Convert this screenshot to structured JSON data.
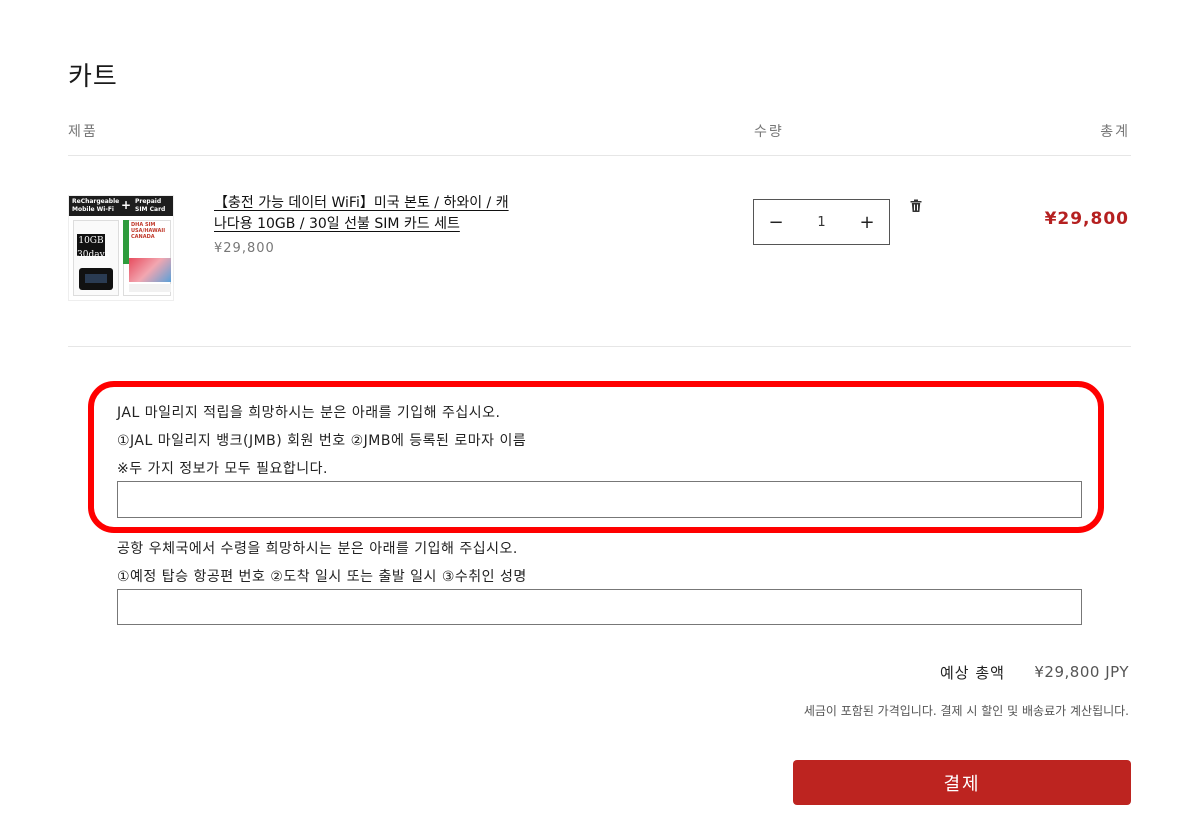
{
  "page": {
    "title": "카트"
  },
  "columns": {
    "product": "제품",
    "quantity": "수량",
    "total": "총계"
  },
  "item": {
    "thumbnail": {
      "band_left": "ReChargeable\nMobile Wi-Fi",
      "band_plus": "+",
      "band_right": "Prepaid\nSIM Card",
      "gb_label": "10GB\n30days",
      "card_text": "DHA SIM USA/HAWAII CANADA"
    },
    "title": "【충전 가능 데이터 WiFi】미국 본토 / 하와이 / 캐나다용 10GB / 30일 선불 SIM 카드 세트",
    "unit_price": "¥29,800",
    "quantity": "1",
    "decrement_label": "−",
    "increment_label": "+",
    "line_total": "¥29,800",
    "delete_icon": "trash-icon"
  },
  "notes": {
    "jal_line1": "JAL 마일리지 적립을 희망하시는 분은 아래를 기입해 주십시오.",
    "jal_line2": "①JAL 마일리지 뱅크(JMB) 회원 번호 ②JMB에 등록된 로마자 이름",
    "jal_line3": "※두 가지 정보가 모두 필요합니다.",
    "jal_input_value": "",
    "airport_line1": "공항 우체국에서 수령을 희망하시는 분은 아래를 기입해 주십시오.",
    "airport_line2": "①예정 탑승 항공편 번호 ②도착 일시 또는 출발 일시 ③수취인 성명",
    "airport_input_value": ""
  },
  "summary": {
    "estimated_label": "예상 총액",
    "estimated_value": "¥29,800 JPY",
    "tax_note": "세금이 포함된 가격입니다. 결제 시 할인 및 배송료가 계산됩니다.",
    "checkout_label": "결제"
  },
  "colors": {
    "accent": "#bd2420",
    "price": "#b52020",
    "highlight_frame": "#ff0000"
  }
}
